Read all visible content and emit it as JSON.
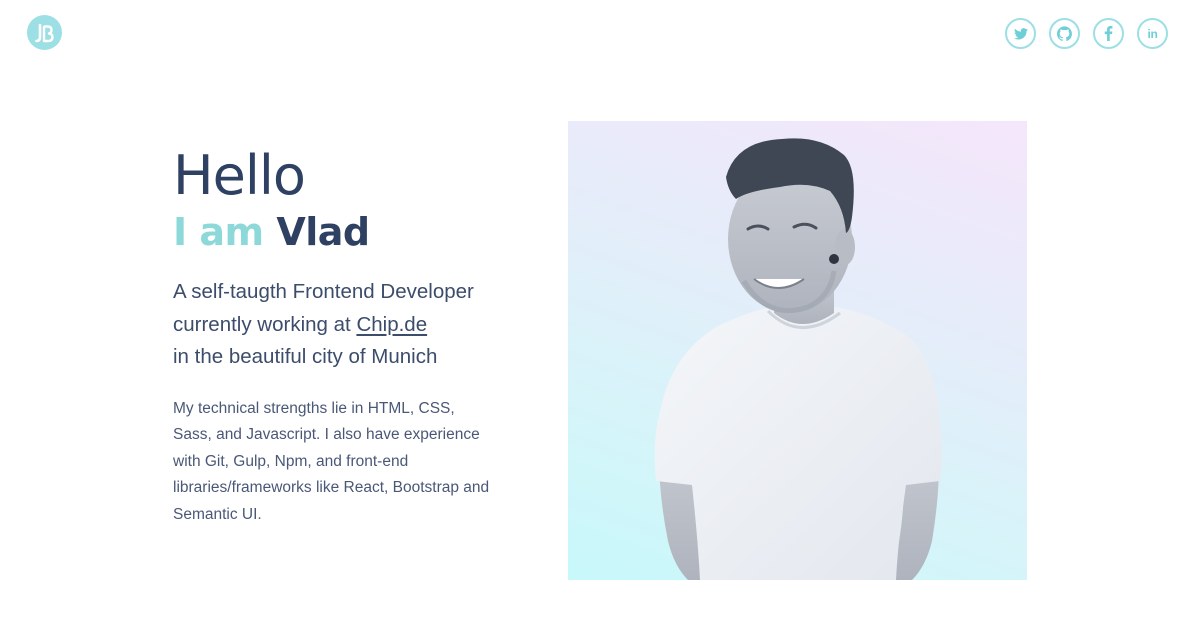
{
  "header": {
    "logo_icon": "jb-monogram-logo",
    "social": [
      {
        "name": "twitter",
        "icon": "twitter-icon"
      },
      {
        "name": "github",
        "icon": "github-icon"
      },
      {
        "name": "facebook",
        "icon": "facebook-icon"
      },
      {
        "name": "linkedin",
        "icon": "linkedin-icon",
        "label": "in"
      }
    ]
  },
  "hero": {
    "greeting": "Hello",
    "iam_prefix": "I am",
    "name": "Vlad",
    "intro_line1": "A self-taugth Frontend Developer",
    "intro_line2_prefix": "currently working at ",
    "company_link": "Chip.de",
    "intro_line3": "in the beautiful city of Munich",
    "skills": "My technical strengths lie in HTML, CSS, Sass, and Javascript. I also have experience with Git, Gulp, Npm, and front-end libraries/frameworks like React, Bootstrap and Semantic UI."
  },
  "colors": {
    "accent": "#8dd8d8",
    "icon_accent": "#9cdfe4",
    "text_dark": "#2f4163",
    "text_body": "#4a5877"
  }
}
